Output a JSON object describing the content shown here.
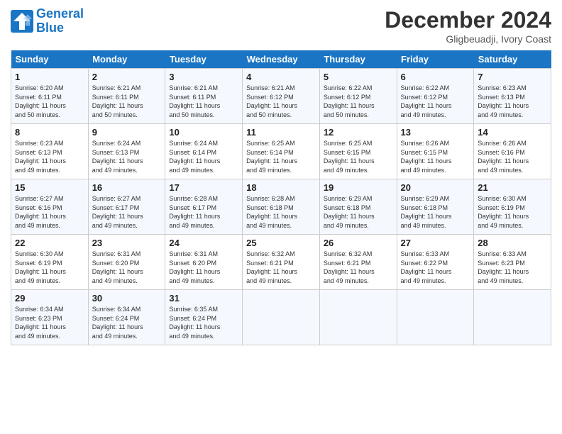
{
  "header": {
    "logo_line1": "General",
    "logo_line2": "Blue",
    "month": "December 2024",
    "location": "Gligbeuadji, Ivory Coast"
  },
  "days_of_week": [
    "Sunday",
    "Monday",
    "Tuesday",
    "Wednesday",
    "Thursday",
    "Friday",
    "Saturday"
  ],
  "weeks": [
    [
      {
        "day": "1",
        "info": "Sunrise: 6:20 AM\nSunset: 6:11 PM\nDaylight: 11 hours\nand 50 minutes."
      },
      {
        "day": "2",
        "info": "Sunrise: 6:21 AM\nSunset: 6:11 PM\nDaylight: 11 hours\nand 50 minutes."
      },
      {
        "day": "3",
        "info": "Sunrise: 6:21 AM\nSunset: 6:11 PM\nDaylight: 11 hours\nand 50 minutes."
      },
      {
        "day": "4",
        "info": "Sunrise: 6:21 AM\nSunset: 6:12 PM\nDaylight: 11 hours\nand 50 minutes."
      },
      {
        "day": "5",
        "info": "Sunrise: 6:22 AM\nSunset: 6:12 PM\nDaylight: 11 hours\nand 50 minutes."
      },
      {
        "day": "6",
        "info": "Sunrise: 6:22 AM\nSunset: 6:12 PM\nDaylight: 11 hours\nand 49 minutes."
      },
      {
        "day": "7",
        "info": "Sunrise: 6:23 AM\nSunset: 6:13 PM\nDaylight: 11 hours\nand 49 minutes."
      }
    ],
    [
      {
        "day": "8",
        "info": "Sunrise: 6:23 AM\nSunset: 6:13 PM\nDaylight: 11 hours\nand 49 minutes."
      },
      {
        "day": "9",
        "info": "Sunrise: 6:24 AM\nSunset: 6:13 PM\nDaylight: 11 hours\nand 49 minutes."
      },
      {
        "day": "10",
        "info": "Sunrise: 6:24 AM\nSunset: 6:14 PM\nDaylight: 11 hours\nand 49 minutes."
      },
      {
        "day": "11",
        "info": "Sunrise: 6:25 AM\nSunset: 6:14 PM\nDaylight: 11 hours\nand 49 minutes."
      },
      {
        "day": "12",
        "info": "Sunrise: 6:25 AM\nSunset: 6:15 PM\nDaylight: 11 hours\nand 49 minutes."
      },
      {
        "day": "13",
        "info": "Sunrise: 6:26 AM\nSunset: 6:15 PM\nDaylight: 11 hours\nand 49 minutes."
      },
      {
        "day": "14",
        "info": "Sunrise: 6:26 AM\nSunset: 6:16 PM\nDaylight: 11 hours\nand 49 minutes."
      }
    ],
    [
      {
        "day": "15",
        "info": "Sunrise: 6:27 AM\nSunset: 6:16 PM\nDaylight: 11 hours\nand 49 minutes."
      },
      {
        "day": "16",
        "info": "Sunrise: 6:27 AM\nSunset: 6:17 PM\nDaylight: 11 hours\nand 49 minutes."
      },
      {
        "day": "17",
        "info": "Sunrise: 6:28 AM\nSunset: 6:17 PM\nDaylight: 11 hours\nand 49 minutes."
      },
      {
        "day": "18",
        "info": "Sunrise: 6:28 AM\nSunset: 6:18 PM\nDaylight: 11 hours\nand 49 minutes."
      },
      {
        "day": "19",
        "info": "Sunrise: 6:29 AM\nSunset: 6:18 PM\nDaylight: 11 hours\nand 49 minutes."
      },
      {
        "day": "20",
        "info": "Sunrise: 6:29 AM\nSunset: 6:18 PM\nDaylight: 11 hours\nand 49 minutes."
      },
      {
        "day": "21",
        "info": "Sunrise: 6:30 AM\nSunset: 6:19 PM\nDaylight: 11 hours\nand 49 minutes."
      }
    ],
    [
      {
        "day": "22",
        "info": "Sunrise: 6:30 AM\nSunset: 6:19 PM\nDaylight: 11 hours\nand 49 minutes."
      },
      {
        "day": "23",
        "info": "Sunrise: 6:31 AM\nSunset: 6:20 PM\nDaylight: 11 hours\nand 49 minutes."
      },
      {
        "day": "24",
        "info": "Sunrise: 6:31 AM\nSunset: 6:20 PM\nDaylight: 11 hours\nand 49 minutes."
      },
      {
        "day": "25",
        "info": "Sunrise: 6:32 AM\nSunset: 6:21 PM\nDaylight: 11 hours\nand 49 minutes."
      },
      {
        "day": "26",
        "info": "Sunrise: 6:32 AM\nSunset: 6:21 PM\nDaylight: 11 hours\nand 49 minutes."
      },
      {
        "day": "27",
        "info": "Sunrise: 6:33 AM\nSunset: 6:22 PM\nDaylight: 11 hours\nand 49 minutes."
      },
      {
        "day": "28",
        "info": "Sunrise: 6:33 AM\nSunset: 6:23 PM\nDaylight: 11 hours\nand 49 minutes."
      }
    ],
    [
      {
        "day": "29",
        "info": "Sunrise: 6:34 AM\nSunset: 6:23 PM\nDaylight: 11 hours\nand 49 minutes."
      },
      {
        "day": "30",
        "info": "Sunrise: 6:34 AM\nSunset: 6:24 PM\nDaylight: 11 hours\nand 49 minutes."
      },
      {
        "day": "31",
        "info": "Sunrise: 6:35 AM\nSunset: 6:24 PM\nDaylight: 11 hours\nand 49 minutes."
      },
      {
        "day": "",
        "info": ""
      },
      {
        "day": "",
        "info": ""
      },
      {
        "day": "",
        "info": ""
      },
      {
        "day": "",
        "info": ""
      }
    ]
  ]
}
